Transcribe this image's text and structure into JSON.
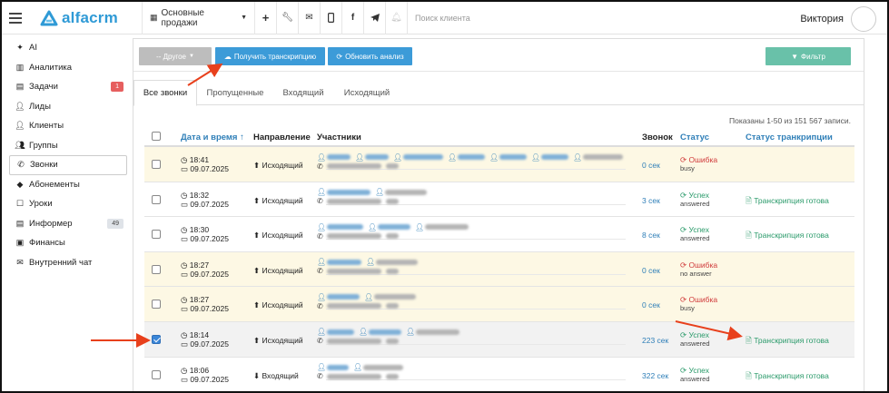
{
  "topbar": {
    "logo": "alfacrm",
    "branch": "Основные продажи",
    "search_placeholder": "Поиск клиента",
    "user_name": "Виктория",
    "icons": [
      "plus-icon",
      "wrench-icon",
      "mail-icon",
      "mobile-icon",
      "facebook-icon",
      "telegram-icon",
      "bell-icon"
    ]
  },
  "sidebar": {
    "items": [
      {
        "label": "AI",
        "icon": "sparkle-icon"
      },
      {
        "label": "Аналитика",
        "icon": "chart-icon"
      },
      {
        "label": "Задачи",
        "icon": "clipboard-icon",
        "badge": "1"
      },
      {
        "label": "Лиды",
        "icon": "user-plus-icon"
      },
      {
        "label": "Клиенты",
        "icon": "user-icon"
      },
      {
        "label": "Группы",
        "icon": "users-icon"
      },
      {
        "label": "Звонки",
        "icon": "phone-icon",
        "active": true
      },
      {
        "label": "Абонементы",
        "icon": "tag-icon"
      },
      {
        "label": "Уроки",
        "icon": "calendar-icon"
      },
      {
        "label": "Информер",
        "icon": "list-icon",
        "badge": "49"
      },
      {
        "label": "Финансы",
        "icon": "money-icon"
      },
      {
        "label": "Внутренний чат",
        "icon": "chat-icon"
      }
    ]
  },
  "toolbar": {
    "other": "-- Другое",
    "transcribe": "Получить транскрипцию",
    "refresh": "Обновить анализ",
    "filter": "Фильтр"
  },
  "tabs": [
    "Все звонки",
    "Пропущенные",
    "Входящий",
    "Исходящий"
  ],
  "records": "Показаны 1-50 из 151 567 записи.",
  "columns": {
    "datetime": "Дата и время ↑",
    "direction": "Направление",
    "participants": "Участники",
    "call": "Звонок",
    "status": "Статус",
    "transcription": "Статус транкрипции"
  },
  "rows": [
    {
      "time": "18:41",
      "date": "09.07.2025",
      "direction": "Исходящий",
      "call": "0 сек",
      "status": "Ошибка",
      "sub": "busy",
      "ok": false,
      "trans": "",
      "bg": "warn",
      "checked": false
    },
    {
      "time": "18:32",
      "date": "09.07.2025",
      "direction": "Исходящий",
      "call": "3 сек",
      "status": "Успех",
      "sub": "answered",
      "ok": true,
      "trans": "Транскрипция готова",
      "bg": "",
      "checked": false
    },
    {
      "time": "18:30",
      "date": "09.07.2025",
      "direction": "Исходящий",
      "call": "8 сек",
      "status": "Успех",
      "sub": "answered",
      "ok": true,
      "trans": "Транскрипция готова",
      "bg": "",
      "checked": false
    },
    {
      "time": "18:27",
      "date": "09.07.2025",
      "direction": "Исходящий",
      "call": "0 сек",
      "status": "Ошибка",
      "sub": "no answer",
      "ok": false,
      "trans": "",
      "bg": "warn",
      "checked": false
    },
    {
      "time": "18:27",
      "date": "09.07.2025",
      "direction": "Исходящий",
      "call": "0 сек",
      "status": "Ошибка",
      "sub": "busy",
      "ok": false,
      "trans": "",
      "bg": "warn",
      "checked": false
    },
    {
      "time": "18:14",
      "date": "09.07.2025",
      "direction": "Исходящий",
      "call": "223 сек",
      "status": "Успех",
      "sub": "answered",
      "ok": true,
      "trans": "Транскрипция готова",
      "bg": "sel",
      "checked": true
    },
    {
      "time": "18:06",
      "date": "09.07.2025",
      "direction": "Входящий",
      "call": "322 сек",
      "status": "Успех",
      "sub": "answered",
      "ok": true,
      "trans": "Транскрипция готова",
      "bg": "",
      "checked": false
    }
  ],
  "colors": {
    "brand": "#2f9ad6",
    "primary_button": "#3c9bd8",
    "filter_button": "#69c1a9",
    "success": "#2a9a6a",
    "error": "#d03a3a",
    "warning_row": "#fdf8e4",
    "annotation_arrow": "#e8401c"
  }
}
